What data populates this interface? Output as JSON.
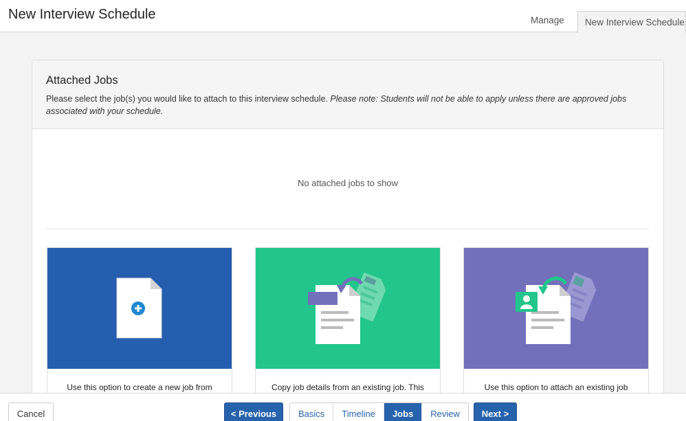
{
  "header": {
    "title": "New Interview Schedule",
    "tabs": [
      {
        "label": "Manage"
      },
      {
        "label": "New Interview Schedule"
      }
    ]
  },
  "panel": {
    "heading": "Attached Jobs",
    "description": "Please select the job(s) you would like to attach to this interview schedule.",
    "note": "Please note: Students will not be able to apply unless there are approved jobs associated with your schedule.",
    "empty_message": "No attached jobs to show"
  },
  "cards": [
    {
      "caption": "Use this option to create a new job from",
      "icon": "new-document-plus-icon",
      "color": "#255eaf"
    },
    {
      "caption": "Copy job details from an existing job. This",
      "icon": "copy-document-icon",
      "color": "#22c58b"
    },
    {
      "caption": "Use this option to attach an existing job",
      "icon": "attach-document-person-icon",
      "color": "#7270bb"
    }
  ],
  "footer": {
    "cancel_label": "Cancel",
    "previous_label": "< Previous",
    "next_label": "Next >",
    "steps": [
      {
        "label": "Basics"
      },
      {
        "label": "Timeline"
      },
      {
        "label": "Jobs"
      },
      {
        "label": "Review"
      }
    ]
  }
}
